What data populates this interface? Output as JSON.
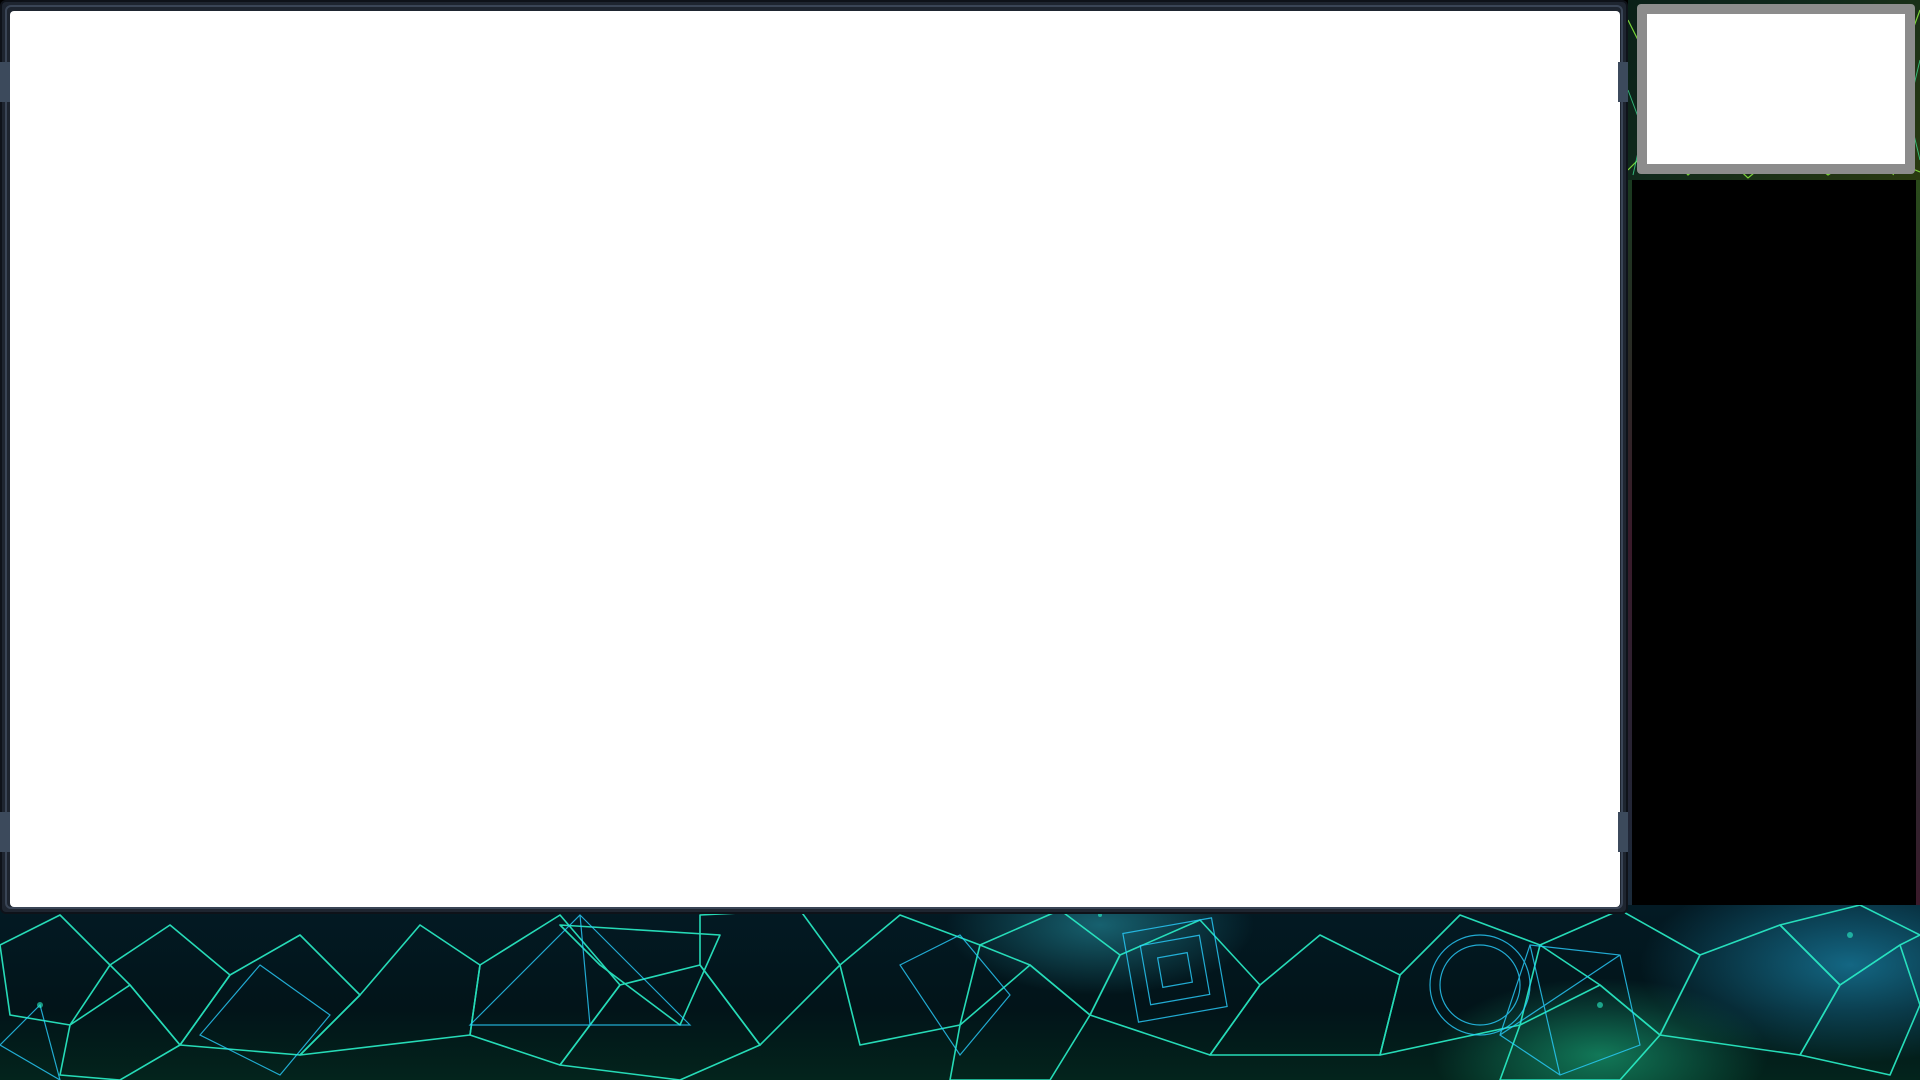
{
  "layout": {
    "regions": [
      "game-capture",
      "webcam",
      "chat",
      "bottom-banner"
    ]
  },
  "colors": {
    "frame": "#1e2530",
    "frame_edge": "#3a4556",
    "screen": "#ffffff",
    "webcam_border": "#8c8c8c",
    "chat_background": "#000000",
    "banner_line_primary": "#2af0c8",
    "banner_line_secondary": "#2ad0ff",
    "banner_background": "#031a24"
  },
  "decoration": {
    "banner_style": "neon-crystal-shards",
    "side_strip_style": "neon-green-lines"
  }
}
